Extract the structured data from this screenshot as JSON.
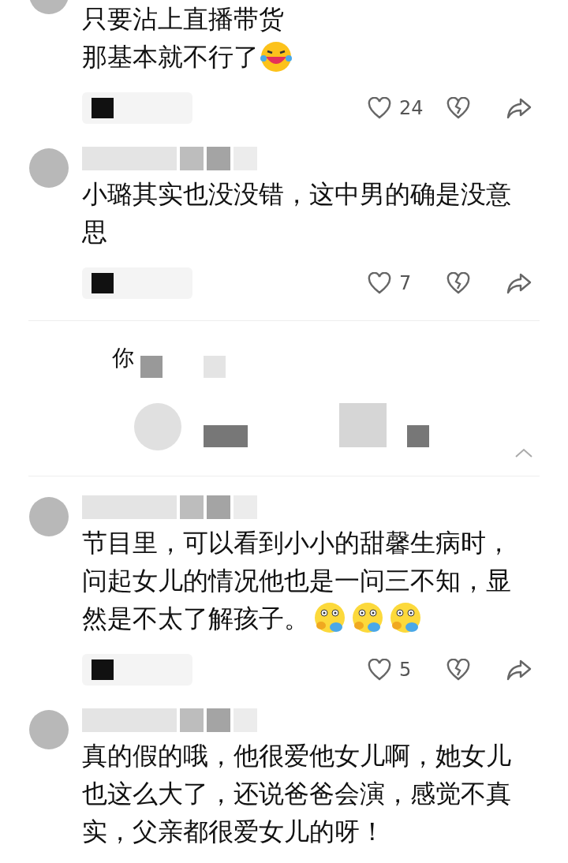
{
  "comments": [
    {
      "kind": "comment",
      "lines": [
        "只要沾上直播带货",
        "那基本就不行了"
      ],
      "emojis": [
        {
          "kind": "laugh"
        }
      ],
      "likes": "24"
    },
    {
      "kind": "comment",
      "lines": [
        "小璐其实也没没错，这中男的确是没意思"
      ],
      "likes": "7"
    },
    {
      "kind": "prompt",
      "title": "你"
    },
    {
      "kind": "comment",
      "lines": [
        "节目里，可以看到小小的甜馨生病时，问起女儿的情况他也是一问三不知，显",
        "然是不太了解孩子。"
      ],
      "emojis": [
        {
          "kind": "yawn"
        },
        {
          "kind": "yawn"
        },
        {
          "kind": "yawn"
        }
      ],
      "likes": "5"
    },
    {
      "kind": "comment",
      "lines": [
        "真的假的哦，他很爱他女儿啊，她女儿也这么大了，还说爸爸会演，感觉不真实，父亲都很爱女儿的呀！"
      ]
    }
  ]
}
